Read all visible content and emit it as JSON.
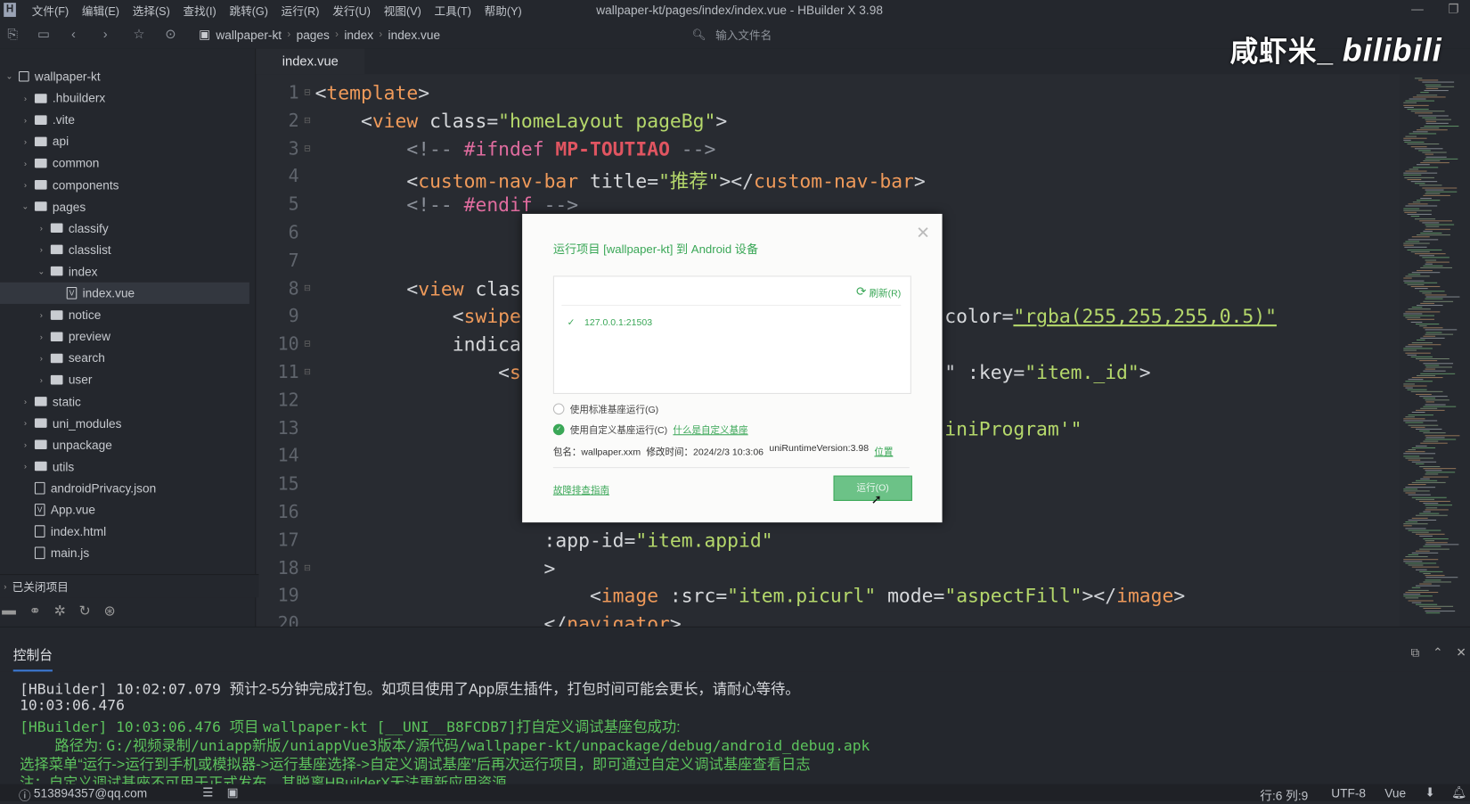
{
  "app": {
    "title": "wallpaper-kt/pages/index/index.vue - HBuilder X 3.98",
    "logo": "H"
  },
  "menu": [
    "文件(F)",
    "编辑(E)",
    "选择(S)",
    "查找(I)",
    "跳转(G)",
    "运行(R)",
    "发行(U)",
    "视图(V)",
    "工具(T)",
    "帮助(Y)"
  ],
  "toolbar": {
    "breadcrumb": [
      "wallpaper-kt",
      "pages",
      "index",
      "index.vue"
    ],
    "file_search_placeholder": "输入文件名"
  },
  "watermark": "咸虾米_ bilibili",
  "sidebar": {
    "items": [
      {
        "label": "wallpaper-kt",
        "type": "project",
        "depth": 0,
        "expanded": true
      },
      {
        "label": ".hbuilderx",
        "type": "folder",
        "depth": 1
      },
      {
        "label": ".vite",
        "type": "folder",
        "depth": 1
      },
      {
        "label": "api",
        "type": "folder",
        "depth": 1
      },
      {
        "label": "common",
        "type": "folder",
        "depth": 1
      },
      {
        "label": "components",
        "type": "folder",
        "depth": 1
      },
      {
        "label": "pages",
        "type": "folder",
        "depth": 1,
        "expanded": true
      },
      {
        "label": "classify",
        "type": "folder",
        "depth": 2
      },
      {
        "label": "classlist",
        "type": "folder",
        "depth": 2
      },
      {
        "label": "index",
        "type": "folder",
        "depth": 2,
        "expanded": true
      },
      {
        "label": "index.vue",
        "type": "file",
        "depth": 3,
        "selected": true,
        "icon": "V"
      },
      {
        "label": "notice",
        "type": "folder",
        "depth": 2
      },
      {
        "label": "preview",
        "type": "folder",
        "depth": 2
      },
      {
        "label": "search",
        "type": "folder",
        "depth": 2
      },
      {
        "label": "user",
        "type": "folder",
        "depth": 2
      },
      {
        "label": "static",
        "type": "folder",
        "depth": 1
      },
      {
        "label": "uni_modules",
        "type": "folder",
        "depth": 1
      },
      {
        "label": "unpackage",
        "type": "folder",
        "depth": 1
      },
      {
        "label": "utils",
        "type": "folder",
        "depth": 1
      },
      {
        "label": "androidPrivacy.json",
        "type": "file",
        "depth": 1,
        "icon": "[ ]"
      },
      {
        "label": "App.vue",
        "type": "file",
        "depth": 1,
        "icon": "V"
      },
      {
        "label": "index.html",
        "type": "file",
        "depth": 1,
        "icon": "<>"
      },
      {
        "label": "main.js",
        "type": "file",
        "depth": 1,
        "icon": "≡"
      }
    ],
    "closed_projects": "已关闭项目"
  },
  "editor": {
    "tab": "index.vue",
    "lines": [
      {
        "n": "1",
        "fold": true,
        "tokens": [
          [
            "punct",
            "<"
          ],
          [
            "tag",
            "template"
          ],
          [
            "punct",
            ">"
          ]
        ]
      },
      {
        "n": "2",
        "fold": true,
        "tokens": [
          [
            "punct",
            "    <"
          ],
          [
            "tag",
            "view"
          ],
          [
            "attr",
            " class"
          ],
          [
            "punct",
            "="
          ],
          [
            "str",
            "\"homeLayout pageBg\""
          ],
          [
            "punct",
            ">"
          ]
        ]
      },
      {
        "n": "3",
        "fold": true,
        "tokens": [
          [
            "comment",
            "        <!-- "
          ],
          [
            "kw",
            "#ifndef"
          ],
          [
            "bold",
            " MP-TOUTIAO"
          ],
          [
            "comment",
            " -->"
          ]
        ]
      },
      {
        "n": "4",
        "tokens": [
          [
            "punct",
            "        <"
          ],
          [
            "tag",
            "custom-nav-bar"
          ],
          [
            "attr",
            " title"
          ],
          [
            "punct",
            "="
          ],
          [
            "str",
            "\"推荐\""
          ],
          [
            "punct",
            "></"
          ],
          [
            "tag",
            "custom-nav-bar"
          ],
          [
            "punct",
            ">"
          ]
        ]
      },
      {
        "n": "5",
        "tokens": [
          [
            "comment",
            "        <!-- "
          ],
          [
            "kw",
            "#endif"
          ],
          [
            "comment",
            " -->"
          ]
        ]
      },
      {
        "n": "6",
        "tokens": []
      },
      {
        "n": "7",
        "tokens": []
      },
      {
        "n": "8",
        "fold": true,
        "tokens": [
          [
            "punct",
            "        <"
          ],
          [
            "tag",
            "view"
          ],
          [
            "attr",
            " clas"
          ]
        ]
      },
      {
        "n": "9",
        "tokens": [
          [
            "punct",
            "            <"
          ],
          [
            "tag",
            "swipe"
          ],
          [
            "punct",
            "                                     "
          ],
          [
            "attr",
            "color"
          ],
          [
            "punct",
            "="
          ],
          [
            "link",
            "\"rgba(255,255,255,0.5)\""
          ]
        ]
      },
      {
        "n": "10",
        "fold": true,
        "tokens": [
          [
            "attr",
            "            indica"
          ]
        ]
      },
      {
        "n": "11",
        "fold": true,
        "tokens": [
          [
            "punct",
            "                <"
          ],
          [
            "tag",
            "s"
          ],
          [
            "punct",
            "                                     \" "
          ],
          [
            "attr",
            ":key"
          ],
          [
            "punct",
            "="
          ],
          [
            "str",
            "\"item._id\""
          ],
          [
            "punct",
            ">"
          ]
        ]
      },
      {
        "n": "12",
        "tokens": []
      },
      {
        "n": "13",
        "tokens": [
          [
            "str",
            "                                                       iniProgram'\""
          ]
        ]
      },
      {
        "n": "14",
        "tokens": []
      },
      {
        "n": "15",
        "tokens": []
      },
      {
        "n": "16",
        "tokens": []
      },
      {
        "n": "17",
        "tokens": [
          [
            "attr",
            "                    :app-id"
          ],
          [
            "punct",
            "="
          ],
          [
            "str",
            "\"item.appid\""
          ]
        ]
      },
      {
        "n": "18",
        "fold": true,
        "tokens": [
          [
            "punct",
            "                    >"
          ]
        ]
      },
      {
        "n": "19",
        "tokens": [
          [
            "punct",
            "                        <"
          ],
          [
            "tag",
            "image"
          ],
          [
            "attr",
            " :src"
          ],
          [
            "punct",
            "="
          ],
          [
            "str",
            "\"item.picurl\""
          ],
          [
            "attr",
            " mode"
          ],
          [
            "punct",
            "="
          ],
          [
            "str",
            "\"aspectFill\""
          ],
          [
            "punct",
            "></"
          ],
          [
            "tag",
            "image"
          ],
          [
            "punct",
            ">"
          ]
        ]
      },
      {
        "n": "20",
        "tokens": [
          [
            "punct",
            "                    </"
          ],
          [
            "tag",
            "navigator"
          ],
          [
            "punct",
            ">"
          ]
        ]
      }
    ]
  },
  "console": {
    "tab": "控制台",
    "lines": [
      {
        "color": "#d4d6da",
        "parts": [
          [
            "[HBuilder] 10:02:07.079 ",
            false
          ],
          [
            "预计2-5分钟完成打包。如项目使用了App原生插件，打包时间可能会更长，请耐心等待。",
            true
          ]
        ]
      },
      {
        "color": "#d4d6da",
        "parts": [
          [
            "10:03:06.476",
            false
          ]
        ]
      },
      {
        "color": "#5cc25c",
        "parts": [
          [
            "[HBuilder] 10:03:06.476 ",
            false
          ],
          [
            "项目 ",
            true
          ],
          [
            "wallpaper-kt [__UNI__B8FCDB7]",
            false
          ],
          [
            "打自定义调试基座包成功:",
            true
          ]
        ]
      },
      {
        "color": "#5cc25c",
        "parts": [
          [
            "    ",
            false
          ],
          [
            "路径为: ",
            true
          ],
          [
            "G:/视频录制/uniapp新版/uniappVue3版本/源代码/wallpaper-kt/unpackage/debug/android_debug.apk",
            false
          ]
        ]
      },
      {
        "color": "#5cc25c",
        "parts": [
          [
            "选择菜单“运行->运行到手机或模拟器->运行基座选择->自定义调试基座”后再次运行项目，即可通过自定义调试基座查看日志",
            true
          ]
        ]
      },
      {
        "color": "#5cc25c",
        "parts": [
          [
            "注：自定义调试基座不可用于正式发布，其脱离HBuilderX无法更新应用资源",
            true
          ]
        ]
      }
    ]
  },
  "status": {
    "user": "513894357@qq.com",
    "position": "行:6  列:9",
    "encoding": "UTF-8",
    "language": "Vue"
  },
  "dialog": {
    "title": "运行项目 [wallpaper-kt] 到 Android 设备",
    "refresh": "刷新(R)",
    "devices": [
      {
        "name": "127.0.0.1:21503",
        "checked": true
      }
    ],
    "option_standard": "使用标准基座运行(G)",
    "option_custom": "使用自定义基座运行(C)",
    "option_custom_selected": true,
    "what_is_custom": "什么是自定义基座",
    "pkg_label": "包名：",
    "pkg_name": "wallpaper.xxm",
    "modified_label": "修改时间：",
    "modified": "2024/2/3 10:3:06",
    "runtime": "uniRuntimeVersion:3.98",
    "location": "位置",
    "guide": "故障排查指南",
    "run": "运行(O)"
  },
  "colors": {
    "accent": "#3aa757",
    "editor_bg": "#282b31",
    "panel_bg": "#24272d"
  }
}
